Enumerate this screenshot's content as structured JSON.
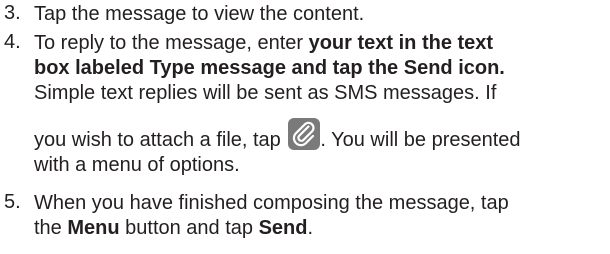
{
  "steps": [
    {
      "number": "3.",
      "lines": [
        {
          "t": "Tap the message to view the content."
        }
      ]
    },
    {
      "number": "4.",
      "l1a": "To reply to the message, enter ",
      "l1b": "your text in the text",
      "l2": "box labeled Type message and tap the Send icon.",
      "l3": "Simple text replies will be sent as SMS messages. If",
      "l4a": "you wish to attach a file, tap ",
      "l4b": ". You will be presented",
      "l5": "with a menu of options."
    },
    {
      "number": "5.",
      "l1": "When you have finished composing the message, tap",
      "l2a": "the ",
      "l2b": "Menu",
      "l2c": " button and tap ",
      "l2d": "Send",
      "l2e": "."
    }
  ],
  "icon": {
    "name": "paperclip-icon",
    "color": "#7a7a7a"
  }
}
